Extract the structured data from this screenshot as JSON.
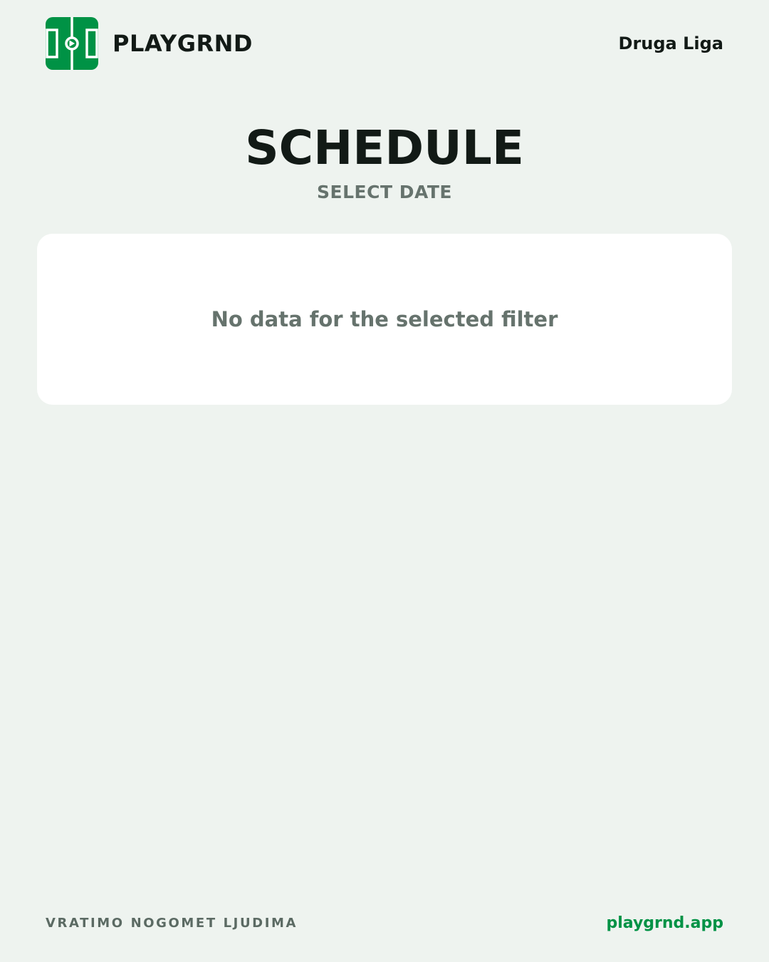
{
  "header": {
    "logo_icon": "soccer-pitch-icon",
    "brand": "PLAYGRND",
    "league": "Druga Liga"
  },
  "main": {
    "title": "SCHEDULE",
    "subtitle": "SELECT DATE",
    "empty_message": "No data for the selected filter"
  },
  "footer": {
    "tagline": "VRATIMO NOGOMET LJUDIMA",
    "site": "playgrnd.app"
  },
  "colors": {
    "brand_green": "#009245",
    "background": "#eef3ef",
    "text_dark": "#121a16",
    "text_muted": "#66736d"
  }
}
